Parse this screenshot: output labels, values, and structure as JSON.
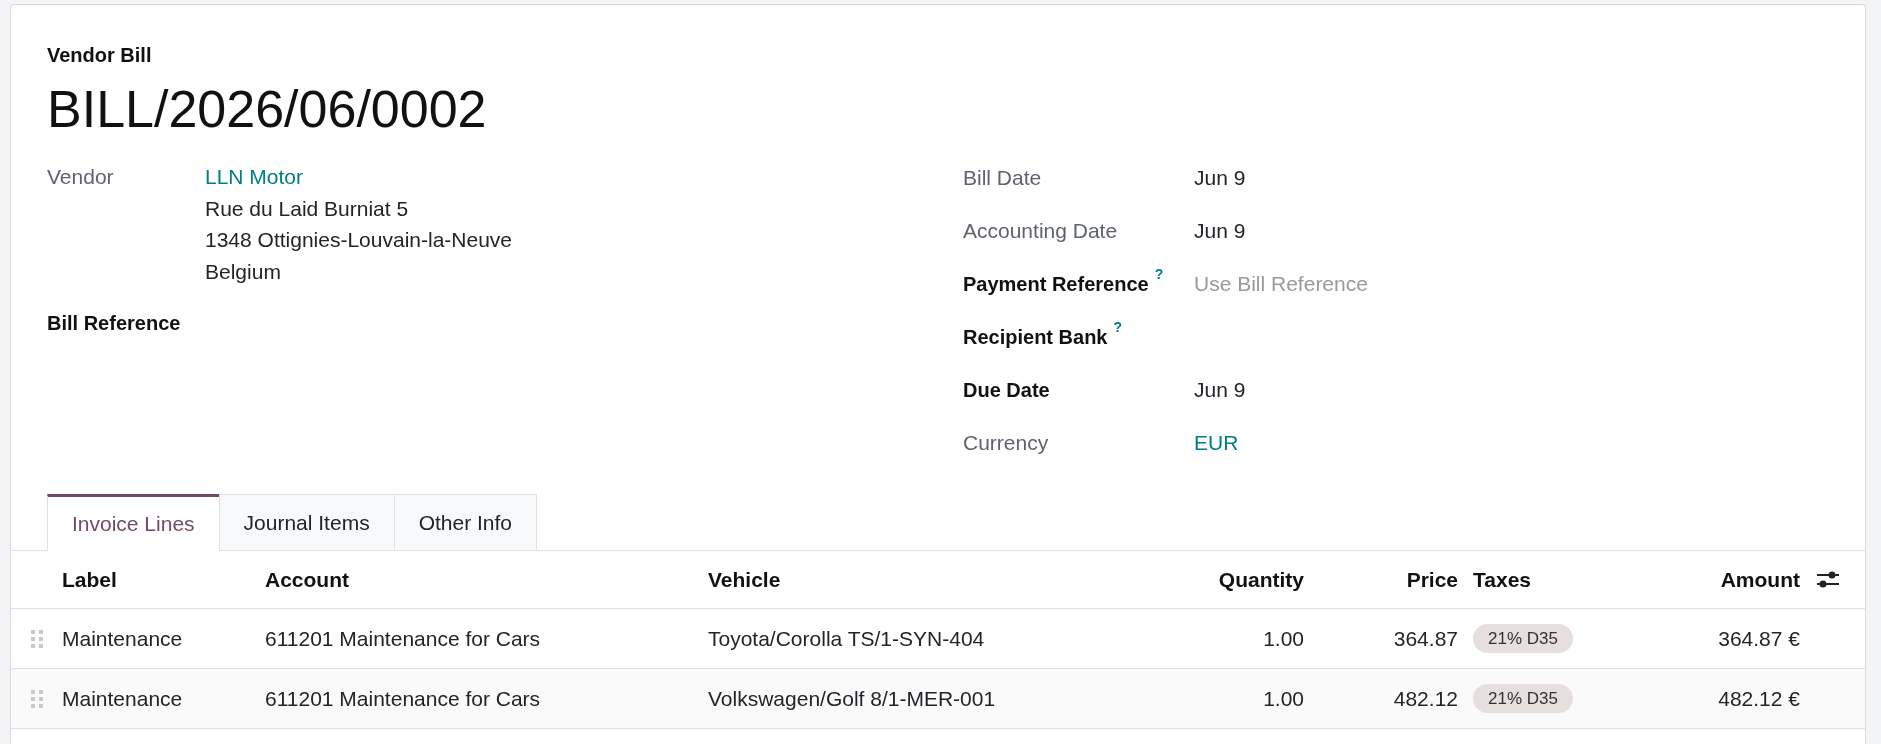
{
  "header": {
    "type_label": "Vendor Bill",
    "number": "BILL/2026/06/0002"
  },
  "left_fields": [
    {
      "label": "Vendor",
      "required": false,
      "kind": "partner",
      "value": "LLN Motor",
      "address_lines": [
        "Rue du Laid Burniat 5",
        "1348 Ottignies-Louvain-la-Neuve",
        "Belgium"
      ]
    },
    {
      "label": "Bill Reference",
      "required": true,
      "kind": "input"
    }
  ],
  "right_fields": [
    {
      "label": "Bill Date",
      "required": false,
      "kind": "date",
      "value": "Jun 9"
    },
    {
      "label": "Accounting Date",
      "required": false,
      "kind": "date",
      "value": "Jun 9"
    },
    {
      "label": "Payment Reference",
      "required": true,
      "help": "?",
      "kind": "input",
      "placeholder": "Use Bill Reference"
    },
    {
      "label": "Recipient Bank",
      "required": true,
      "help": "?",
      "kind": "input"
    },
    {
      "label": "Due Date",
      "required": true,
      "kind": "date",
      "value": "Jun 9"
    },
    {
      "label": "Currency",
      "required": false,
      "kind": "link",
      "value": "EUR"
    }
  ],
  "tabs": [
    {
      "label": "Invoice Lines",
      "selected": true
    },
    {
      "label": "Journal Items",
      "selected": false
    },
    {
      "label": "Other Info",
      "selected": false
    }
  ],
  "invoice_lines": {
    "columns": [
      {
        "label": "Label",
        "kind": "text"
      },
      {
        "label": "Account",
        "kind": "text"
      },
      {
        "label": "Vehicle",
        "kind": "text"
      },
      {
        "label": "Quantity",
        "kind": "number"
      },
      {
        "label": "Price",
        "kind": "number"
      },
      {
        "label": "Taxes",
        "kind": "tag"
      },
      {
        "label": "Amount",
        "kind": "number"
      }
    ],
    "rows": [
      {
        "cells": [
          "Maintenance",
          "611201 Maintenance for Cars",
          "Toyota/Corolla TS/1-SYN-404",
          "1.00",
          "364.87",
          "21% D35",
          "364.87 €"
        ]
      },
      {
        "cells": [
          "Maintenance",
          "611201 Maintenance for Cars",
          "Volkswagen/Golf 8/1-MER-001",
          "1.00",
          "482.12",
          "21% D35",
          "482.12 €"
        ]
      }
    ]
  }
}
